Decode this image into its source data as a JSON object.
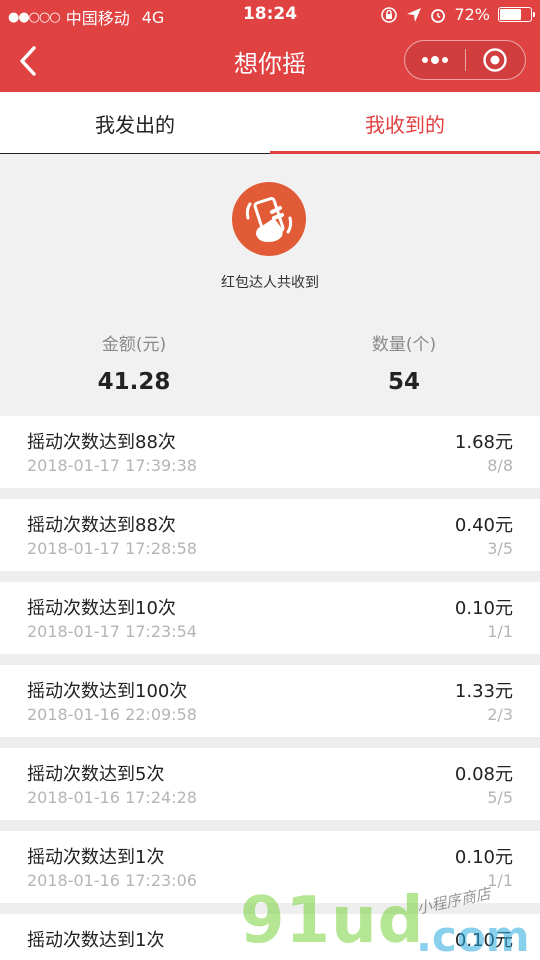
{
  "status_bar": {
    "signal": "●●○○○",
    "carrier": "中国移动",
    "network": "4G",
    "time": "18:24",
    "battery_percent": "72%",
    "battery_level": 0.72
  },
  "nav": {
    "title": "想你摇",
    "more_icon": "more-dots-icon",
    "close_icon": "target-close-icon"
  },
  "tabs": [
    {
      "label": "我发出的",
      "active": false
    },
    {
      "label": "我收到的",
      "active": true
    }
  ],
  "summary": {
    "caption": "红包达人共收到",
    "amount_label": "金额(元)",
    "amount_value": "41.28",
    "count_label": "数量(个)",
    "count_value": "54"
  },
  "records": [
    {
      "title": "摇动次数达到88次",
      "time": "2018-01-17 17:39:38",
      "amount": "1.68元",
      "ratio": "8/8"
    },
    {
      "title": "摇动次数达到88次",
      "time": "2018-01-17 17:28:58",
      "amount": "0.40元",
      "ratio": "3/5"
    },
    {
      "title": "摇动次数达到10次",
      "time": "2018-01-17 17:23:54",
      "amount": "0.10元",
      "ratio": "1/1"
    },
    {
      "title": "摇动次数达到100次",
      "time": "2018-01-16 22:09:58",
      "amount": "1.33元",
      "ratio": "2/3"
    },
    {
      "title": "摇动次数达到5次",
      "time": "2018-01-16 17:24:28",
      "amount": "0.08元",
      "ratio": "5/5"
    },
    {
      "title": "摇动次数达到1次",
      "time": "2018-01-16 17:23:06",
      "amount": "0.10元",
      "ratio": "1/1"
    },
    {
      "title": "摇动次数达到1次",
      "time": "",
      "amount": "0.10元",
      "ratio": ""
    }
  ],
  "watermark": {
    "main": "91ud",
    "suffix": ".com",
    "side_text": "小程序商店"
  },
  "colors": {
    "brand_red": "#e04141",
    "avatar_orange": "#e05b36"
  }
}
